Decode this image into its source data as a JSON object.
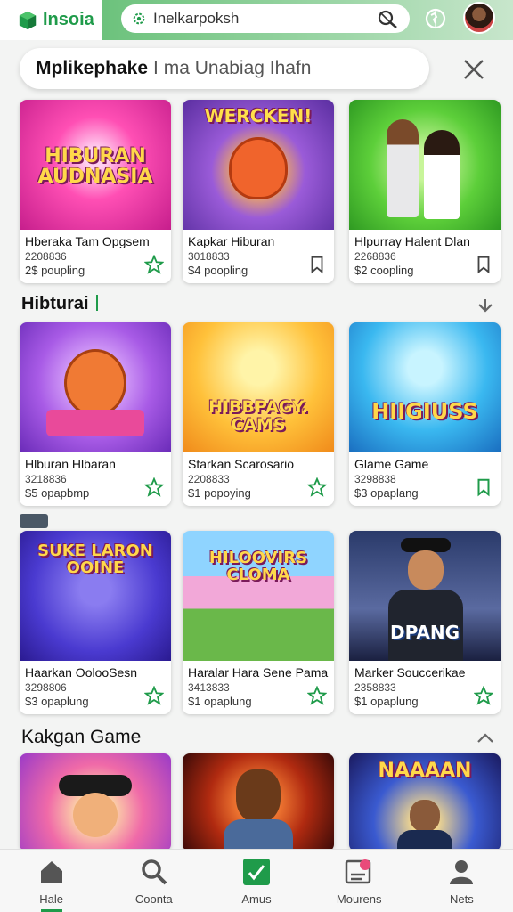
{
  "header": {
    "logo_text": "Insoia",
    "search_value": "Inelkarpoksh",
    "accent_color": "#1f9b4a",
    "icons": [
      "logo-cube-icon",
      "gear-icon",
      "search-icon",
      "globe-icon",
      "avatar"
    ]
  },
  "banner": {
    "title": "Mplikephake",
    "subtitle": "I ma Unabiag Ihafn",
    "close_icon": "close-icon"
  },
  "row1": [
    {
      "thumb_text": "HIBURAN AUDNASIA",
      "title": "Hberaka Tam Opgsem",
      "meta1": "2208836",
      "meta2": "2$ poupling",
      "bookmark": "star-outline-icon"
    },
    {
      "thumb_text": "WERCKEN!",
      "title": "Kapkar Hiburan",
      "meta1": "3018833",
      "meta2": "$4 poopling",
      "bookmark": "bookmark-outline-icon"
    },
    {
      "thumb_text": "",
      "title": "Hlpurray Halent Dlan",
      "meta1": "2268836",
      "meta2": "$2 coopling",
      "bookmark": "bookmark-outline-icon"
    }
  ],
  "section1": {
    "title": "Hibturai",
    "icon": "chevron-down-icon"
  },
  "row2": [
    {
      "thumb_text": "",
      "title": "Hlburan Hlbaran",
      "meta1": "3218836",
      "meta2": "$5 opapbmp",
      "bookmark": "star-outline-icon"
    },
    {
      "thumb_text": "HIBBPAGY. CAMS",
      "title": "Starkan Scarosario",
      "meta1": "2208833",
      "meta2": "$1 popoying",
      "bookmark": "star-outline-icon"
    },
    {
      "thumb_text": "HIIGIUSS",
      "title": "Glame Game",
      "meta1": "3298838",
      "meta2": "$3 opaplang",
      "bookmark": "bookmark-outline-icon"
    }
  ],
  "row3": [
    {
      "thumb_text": "SUKE LARON OOINE",
      "title": "Haarkan OolooSesn",
      "meta1": "3298806",
      "meta2": "$3 opaplung",
      "bookmark": "star-outline-icon"
    },
    {
      "thumb_text": "HILOOVIRS CLOMA",
      "title": "Haralar Hara Sene Pama",
      "meta1": "3413833",
      "meta2": "$1 opaplung",
      "bookmark": "star-outline-icon"
    },
    {
      "thumb_text": "DPANG",
      "title": "Marker Souccerikae",
      "meta1": "2358833",
      "meta2": "$1 opaplung",
      "bookmark": "star-outline-icon"
    }
  ],
  "section2": {
    "title": "Kakgan Game",
    "icon": "chevron-up-icon"
  },
  "row4": [
    {
      "thumb_text": ""
    },
    {
      "thumb_text": ""
    },
    {
      "thumb_text": "NAAAAN"
    }
  ],
  "nav": [
    {
      "label": "Hale",
      "icon": "home-icon",
      "active": true
    },
    {
      "label": "Coonta",
      "icon": "search-icon",
      "active": false
    },
    {
      "label": "Amus",
      "icon": "check-square-icon",
      "active": false
    },
    {
      "label": "Mourens",
      "icon": "image-icon",
      "active": false
    },
    {
      "label": "Nets",
      "icon": "profile-icon",
      "active": false
    }
  ]
}
